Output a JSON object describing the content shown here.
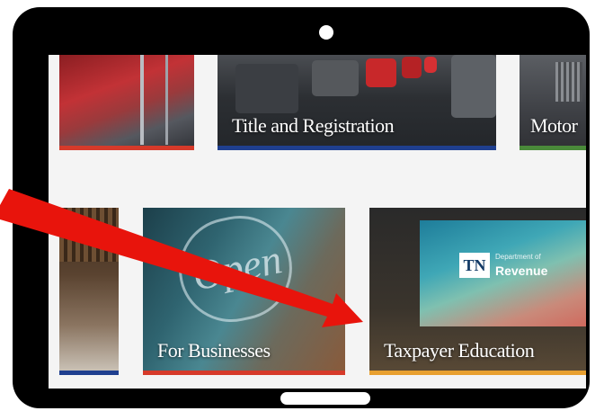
{
  "tiles": {
    "title_registration": {
      "label": "Title and Registration",
      "bar_color": "#1f3f8f"
    },
    "motor": {
      "label": "Motor",
      "bar_color": "#4a8a3a"
    },
    "flags": {
      "bar_color": "#d63a2a"
    },
    "library": {
      "bar_color": "#1f3f8f"
    },
    "for_businesses": {
      "label": "For Businesses",
      "bar_color": "#d63a2a"
    },
    "taxpayer_education": {
      "label": "Taxpayer Education",
      "bar_color": "#e8a030"
    }
  },
  "taxpayer_screen": {
    "logo": "TN",
    "department": "Department of",
    "revenue": "Revenue"
  },
  "open_sign": "Open",
  "arrow_color": "#e8140c"
}
